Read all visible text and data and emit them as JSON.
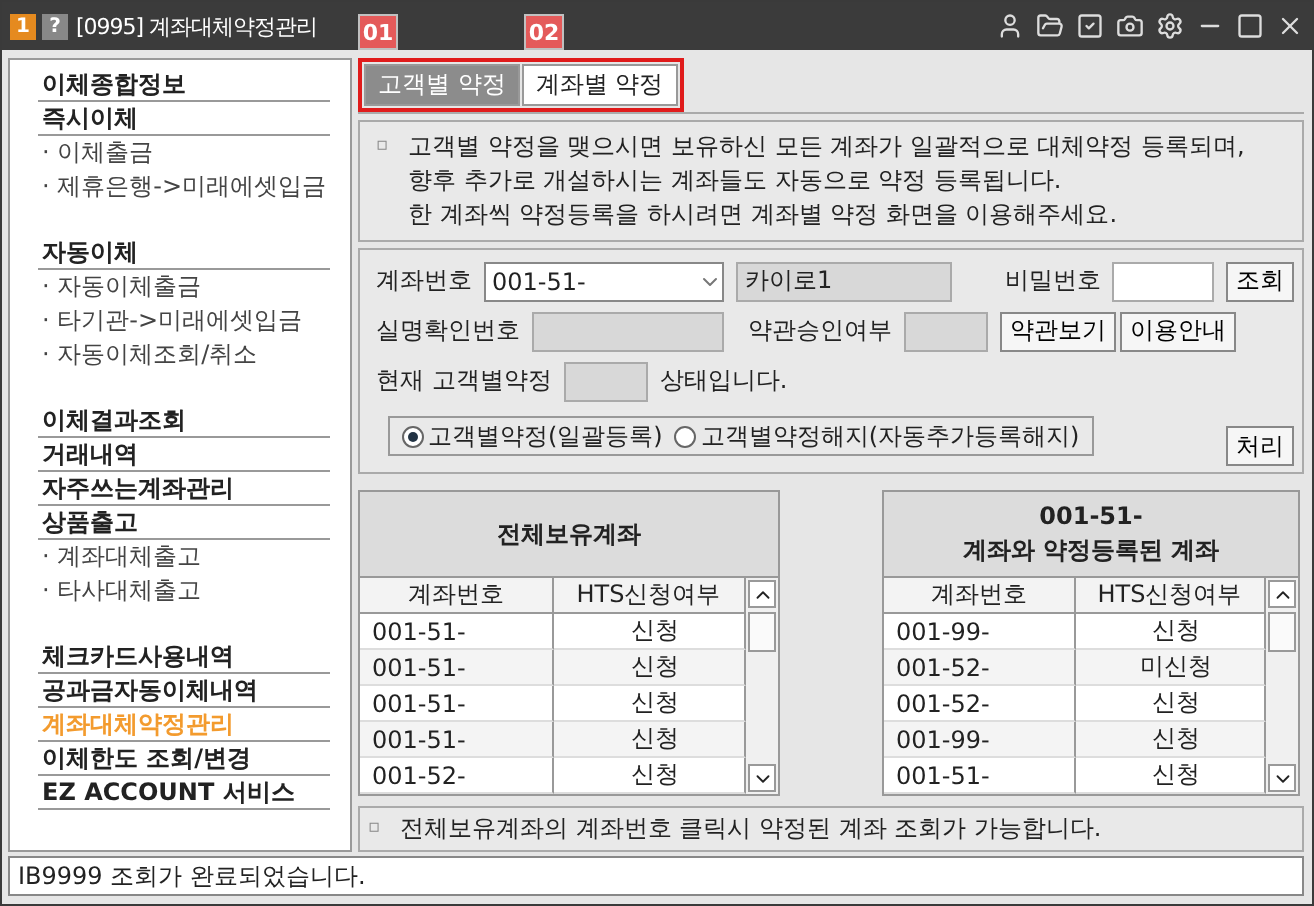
{
  "window": {
    "badges": [
      "1",
      "?"
    ],
    "title": "[0995] 계좌대체약정관리"
  },
  "markers": [
    "01",
    "02"
  ],
  "sidebar": {
    "groups": [
      {
        "items": [
          {
            "label": "이체종합정보",
            "kind": "heading",
            "selected": false
          },
          {
            "label": "즉시이체",
            "kind": "heading",
            "selected": false
          },
          {
            "label": "· 이체출금",
            "kind": "sub",
            "selected": false
          },
          {
            "label": "· 제휴은행->미래에셋입금",
            "kind": "sub",
            "selected": false
          }
        ]
      },
      {
        "items": [
          {
            "label": "자동이체",
            "kind": "heading",
            "selected": false
          },
          {
            "label": "· 자동이체출금",
            "kind": "sub",
            "selected": false
          },
          {
            "label": "· 타기관->미래에셋입금",
            "kind": "sub",
            "selected": false
          },
          {
            "label": "· 자동이체조회/취소",
            "kind": "sub",
            "selected": false
          }
        ]
      },
      {
        "items": [
          {
            "label": "이체결과조회",
            "kind": "heading",
            "selected": false
          },
          {
            "label": "거래내역",
            "kind": "heading",
            "selected": false
          },
          {
            "label": "자주쓰는계좌관리",
            "kind": "heading",
            "selected": false
          },
          {
            "label": "상품출고",
            "kind": "heading",
            "selected": false
          },
          {
            "label": "· 계좌대체출고",
            "kind": "sub",
            "selected": false
          },
          {
            "label": "· 타사대체출고",
            "kind": "sub",
            "selected": false
          }
        ]
      },
      {
        "items": [
          {
            "label": "체크카드사용내역",
            "kind": "heading",
            "selected": false
          },
          {
            "label": "공과금자동이체내역",
            "kind": "heading",
            "selected": false
          },
          {
            "label": "계좌대체약정관리",
            "kind": "heading",
            "selected": true
          },
          {
            "label": "이체한도 조회/변경",
            "kind": "heading",
            "selected": false
          },
          {
            "label": "EZ ACCOUNT 서비스",
            "kind": "heading",
            "selected": false
          }
        ]
      }
    ]
  },
  "tabs": [
    {
      "label": "고객별 약정",
      "selected": true
    },
    {
      "label": "계좌별 약정",
      "selected": false
    }
  ],
  "info": {
    "bullet": "▫",
    "lines": [
      "고객별 약정을 맺으시면 보유하신 모든 계좌가 일괄적으로 대체약정 등록되며,",
      "향후 추가로 개설하시는 계좌들도 자동으로 약정 등록됩니다.",
      "한 계좌씩 약정등록을 하시려면 계좌별 약정 화면을 이용해주세요."
    ]
  },
  "form": {
    "account_label": "계좌번호",
    "account_value": "001-51-",
    "account_name": "카이로1",
    "password_label": "비밀번호",
    "lookup_button": "조회",
    "id_label": "실명확인번호",
    "terms_label": "약관승인여부",
    "terms_button": "약관보기",
    "guide_button": "이용안내",
    "status_prefix": "현재 고객별약정",
    "status_suffix": "상태입니다.",
    "options": [
      {
        "label": "고객별약정(일괄등록)",
        "selected": true
      },
      {
        "label": "고객별약정해지(자동추가등록해지)",
        "selected": false
      }
    ],
    "process_button": "처리"
  },
  "all_accounts": {
    "title_lines": [
      "전체보유계좌"
    ],
    "columns": [
      "계좌번호",
      "HTS신청여부"
    ],
    "rows": [
      [
        "001-51-",
        "신청"
      ],
      [
        "001-51-",
        "신청"
      ],
      [
        "001-51-",
        "신청"
      ],
      [
        "001-51-",
        "신청"
      ],
      [
        "001-52-",
        "신청"
      ]
    ]
  },
  "linked_accounts": {
    "title_lines": [
      "001-51-",
      "계좌와 약정등록된 계좌"
    ],
    "columns": [
      "계좌번호",
      "HTS신청여부"
    ],
    "rows": [
      [
        "001-99-",
        "신청"
      ],
      [
        "001-52-",
        "미신청"
      ],
      [
        "001-52-",
        "신청"
      ],
      [
        "001-99-",
        "신청"
      ],
      [
        "001-51-",
        "신청"
      ]
    ]
  },
  "note": {
    "bullet": "▫",
    "text": "전체보유계좌의 계좌번호 클릭시 약정된 계좌 조회가 가능합니다."
  },
  "status_bar": "IB9999  조회가 완료되었습니다."
}
